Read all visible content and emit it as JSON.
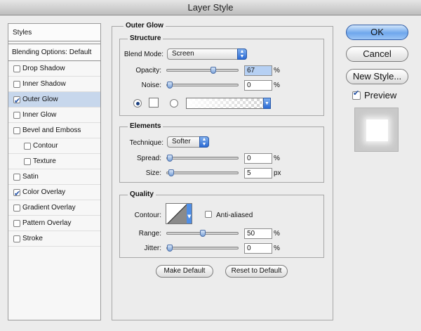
{
  "window": {
    "title": "Layer Style"
  },
  "styles_panel": {
    "header": "Styles",
    "blending": "Blending Options: Default",
    "items": [
      {
        "label": "Drop Shadow",
        "checked": false,
        "indent": false,
        "selected": false
      },
      {
        "label": "Inner Shadow",
        "checked": false,
        "indent": false,
        "selected": false
      },
      {
        "label": "Outer Glow",
        "checked": true,
        "indent": false,
        "selected": true
      },
      {
        "label": "Inner Glow",
        "checked": false,
        "indent": false,
        "selected": false
      },
      {
        "label": "Bevel and Emboss",
        "checked": false,
        "indent": false,
        "selected": false
      },
      {
        "label": "Contour",
        "checked": false,
        "indent": true,
        "selected": false
      },
      {
        "label": "Texture",
        "checked": false,
        "indent": true,
        "selected": false
      },
      {
        "label": "Satin",
        "checked": false,
        "indent": false,
        "selected": false
      },
      {
        "label": "Color Overlay",
        "checked": true,
        "indent": false,
        "selected": false
      },
      {
        "label": "Gradient Overlay",
        "checked": false,
        "indent": false,
        "selected": false
      },
      {
        "label": "Pattern Overlay",
        "checked": false,
        "indent": false,
        "selected": false
      },
      {
        "label": "Stroke",
        "checked": false,
        "indent": false,
        "selected": false
      }
    ]
  },
  "outer_glow": {
    "title": "Outer Glow",
    "structure": {
      "title": "Structure",
      "blend_mode_label": "Blend Mode:",
      "blend_mode_value": "Screen",
      "opacity_label": "Opacity:",
      "opacity_value": "67",
      "opacity_percent": 67,
      "opacity_unit": "%",
      "noise_label": "Noise:",
      "noise_value": "0",
      "noise_percent": 0,
      "noise_unit": "%",
      "color_mode": "solid"
    },
    "elements": {
      "title": "Elements",
      "technique_label": "Technique:",
      "technique_value": "Softer",
      "spread_label": "Spread:",
      "spread_value": "0",
      "spread_percent": 0,
      "spread_unit": "%",
      "size_label": "Size:",
      "size_value": "5",
      "size_fraction": 0.02,
      "size_unit": "px"
    },
    "quality": {
      "title": "Quality",
      "contour_label": "Contour:",
      "anti_aliased_label": "Anti-aliased",
      "anti_aliased": false,
      "range_label": "Range:",
      "range_value": "50",
      "range_percent": 50,
      "range_unit": "%",
      "jitter_label": "Jitter:",
      "jitter_value": "0",
      "jitter_percent": 0,
      "jitter_unit": "%"
    },
    "make_default": "Make Default",
    "reset_default": "Reset to Default"
  },
  "actions": {
    "ok": "OK",
    "cancel": "Cancel",
    "new_style": "New Style...",
    "preview_label": "Preview",
    "preview_checked": true
  },
  "colors": {
    "accent": "#6ea7ec",
    "selection": "#c7d7ec",
    "check": "#2755a8"
  }
}
